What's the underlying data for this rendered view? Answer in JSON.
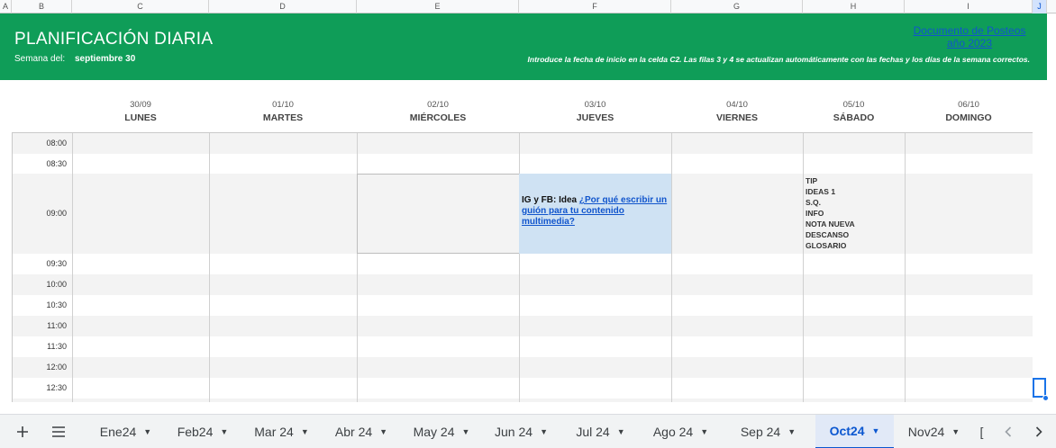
{
  "columns": [
    "A",
    "B",
    "C",
    "D",
    "E",
    "F",
    "G",
    "H",
    "I",
    "J"
  ],
  "banner": {
    "title": "PLANIFICACIÓN DIARIA",
    "week_label": "Semana del:",
    "week_value": "septiembre 30",
    "doc_link": "Documento de Posteos año 2023",
    "instructions": "Introduce la fecha de inicio en la celda C2. Las filas 3 y 4 se actualizan automáticamente con las fechas y los días de la semana correctos."
  },
  "days": [
    {
      "date": "30/09",
      "name": "LUNES"
    },
    {
      "date": "01/10",
      "name": "MARTES"
    },
    {
      "date": "02/10",
      "name": "MIÉRCOLES"
    },
    {
      "date": "03/10",
      "name": "JUEVES"
    },
    {
      "date": "04/10",
      "name": "VIERNES"
    },
    {
      "date": "05/10",
      "name": "SÁBADO"
    },
    {
      "date": "06/10",
      "name": "DOMINGO"
    }
  ],
  "times": [
    "08:00",
    "08:30",
    "09:00",
    "09:30",
    "10:00",
    "10:30",
    "11:00",
    "11:30",
    "12:00",
    "12:30"
  ],
  "entries": {
    "thursday_prefix": "IG y FB: Idea ",
    "thursday_link": "¿Por qué escribir un guión para tu contenido multimedia?",
    "saturday_items": [
      "TIP",
      "IDEAS 1",
      "S.Q.",
      "INFO",
      "NOTA NUEVA",
      "DESCANSO",
      "GLOSARIO"
    ]
  },
  "sheet_tabs": [
    {
      "label": "Ene24",
      "active": false
    },
    {
      "label": "Feb24",
      "active": false
    },
    {
      "label": "Mar 24",
      "active": false
    },
    {
      "label": "Abr 24",
      "active": false
    },
    {
      "label": "May 24",
      "active": false
    },
    {
      "label": "Jun 24",
      "active": false
    },
    {
      "label": "Jul 24",
      "active": false
    },
    {
      "label": "Ago 24",
      "active": false
    },
    {
      "label": "Sep 24",
      "active": false
    },
    {
      "label": "Oct24",
      "active": true
    },
    {
      "label": "Nov24",
      "active": false
    },
    {
      "label": "[",
      "active": false
    }
  ],
  "icons": {
    "add_sheet": "plus-icon",
    "all_sheets": "hamburger-menu-icon",
    "scroll_left": "chevron-left-icon",
    "scroll_right": "chevron-right-icon"
  },
  "colors": {
    "banner": "#0f9d58",
    "link": "#1155cc",
    "highlight_cell": "#cfe2f3",
    "active_tab": "#0b57d0"
  }
}
